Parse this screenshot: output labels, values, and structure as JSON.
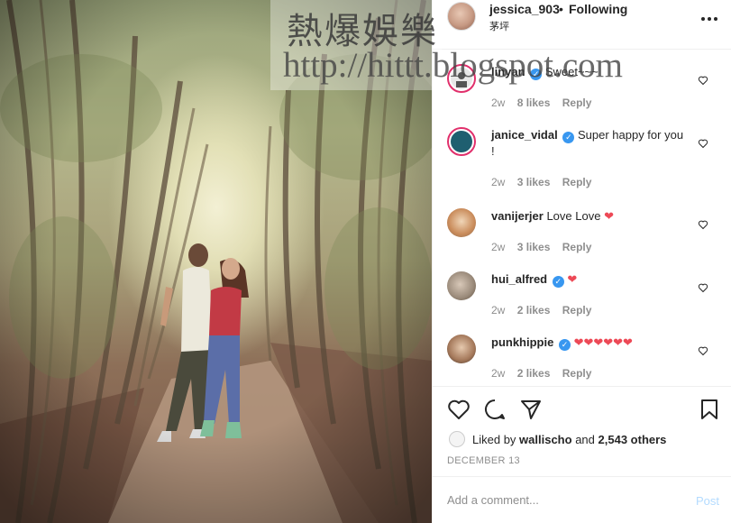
{
  "watermark": {
    "chinese": "熱爆娛樂",
    "url": "http://hittt.blogspot.com"
  },
  "header": {
    "username": "jessica_903",
    "separator": "•",
    "follow_status": "Following",
    "location": "茅坪",
    "more_icon": "more-horizontal-icon"
  },
  "comments": [
    {
      "user": "linyan",
      "verified": true,
      "text": "Sweet~~~",
      "hearts": 0,
      "age": "2w",
      "likes": "8 likes",
      "reply": "Reply"
    },
    {
      "user": "janice_vidal",
      "verified": true,
      "text": "Super happy for you !",
      "hearts": 0,
      "age": "2w",
      "likes": "3 likes",
      "reply": "Reply"
    },
    {
      "user": "vanijerjer",
      "verified": false,
      "text": "Love Love",
      "hearts": 1,
      "age": "2w",
      "likes": "3 likes",
      "reply": "Reply"
    },
    {
      "user": "hui_alfred",
      "verified": true,
      "text": "",
      "hearts": 1,
      "age": "2w",
      "likes": "2 likes",
      "reply": "Reply"
    },
    {
      "user": "punkhippie",
      "verified": true,
      "text": "",
      "hearts": 6,
      "age": "2w",
      "likes": "2 likes",
      "reply": "Reply"
    }
  ],
  "actions": {
    "liked_by_prefix": "Liked by",
    "liked_by_user": "wallischo",
    "liked_by_and": "and",
    "liked_by_others": "2,543 others",
    "date": "DECEMBER 13"
  },
  "add_comment": {
    "placeholder": "Add a comment...",
    "post_label": "Post"
  },
  "colors": {
    "verified": "#3897f0",
    "heart": "#ed4956",
    "post_disabled": "#b3dbff",
    "meta_grey": "#8e8e8e"
  }
}
